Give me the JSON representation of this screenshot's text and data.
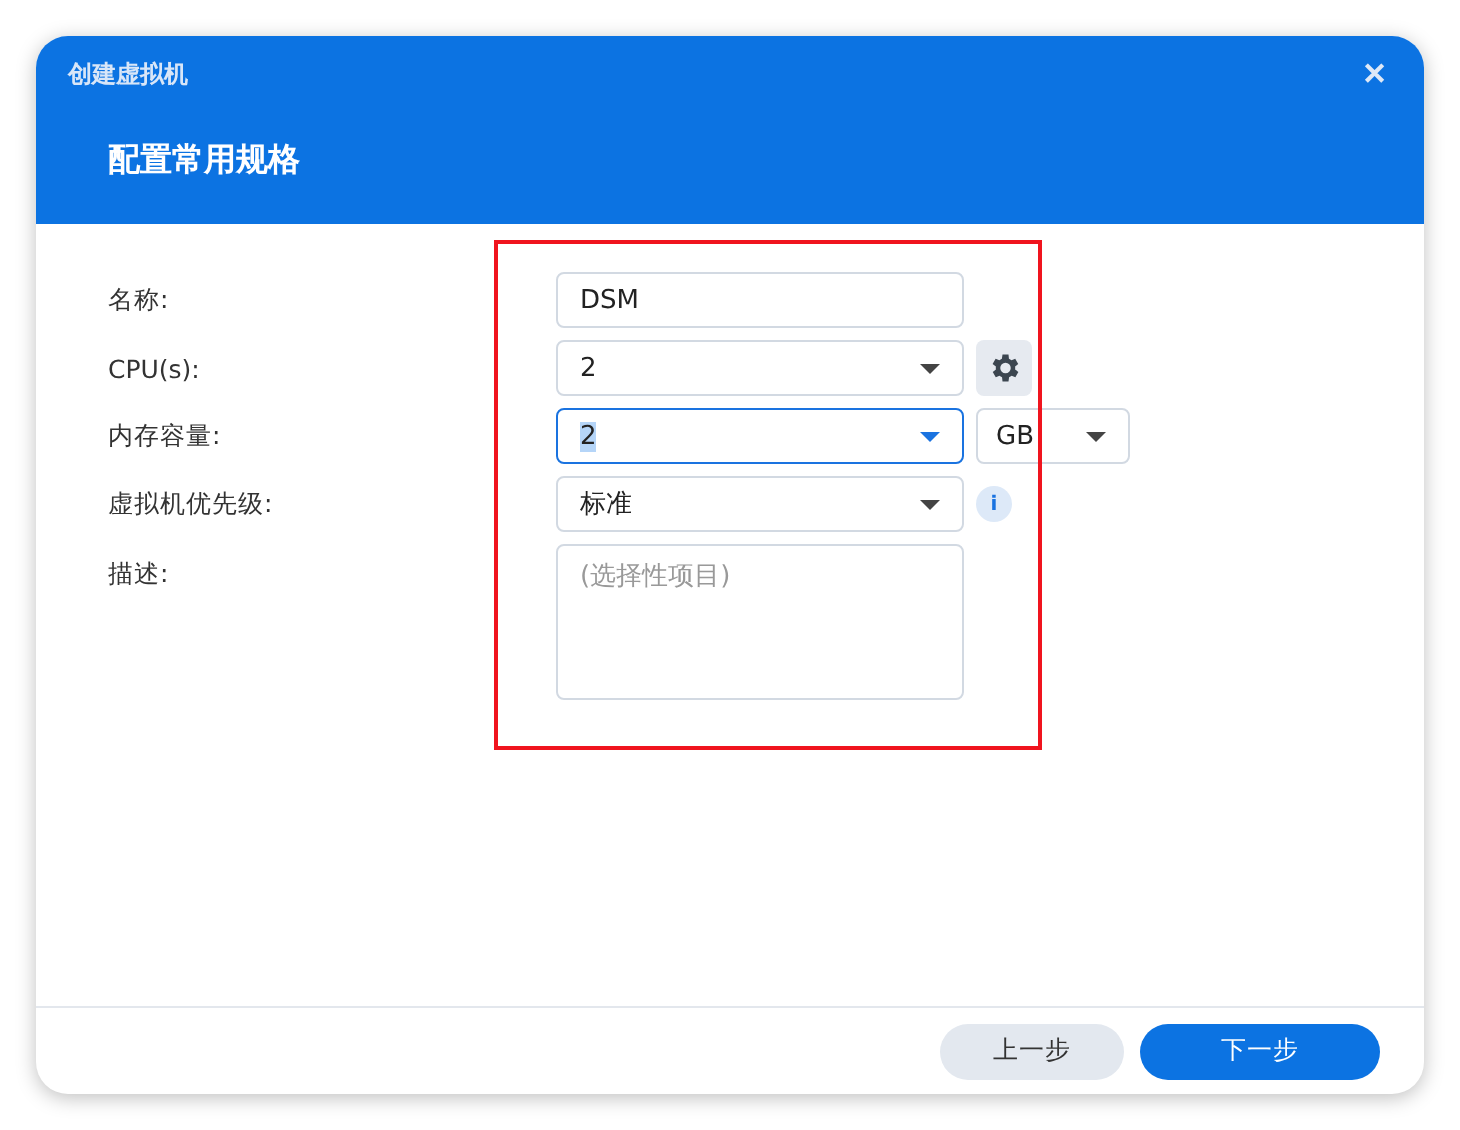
{
  "window": {
    "title": "创建虚拟机",
    "close": "✕"
  },
  "header": {
    "title": "配置常用规格"
  },
  "form": [
    {
      "label": "名称:",
      "kind": "text",
      "value": "DSM",
      "focused": false
    },
    {
      "label": "CPU(s):",
      "kind": "select",
      "value": "2",
      "focused": false,
      "extra": {
        "kind": "gear"
      }
    },
    {
      "label": "内存容量:",
      "kind": "select",
      "value": "2",
      "focused": true,
      "extra": {
        "kind": "unit",
        "value": "GB"
      }
    },
    {
      "label": "虚拟机优先级:",
      "kind": "select",
      "value": "标准",
      "focused": false,
      "extra": {
        "kind": "info",
        "text": "i"
      }
    },
    {
      "label": "描述:",
      "kind": "textarea",
      "placeholder": "(选择性项目)",
      "focused": false
    }
  ],
  "buttons": [
    {
      "label": "上一步",
      "primary": false
    },
    {
      "label": "下一步",
      "primary": true
    }
  ]
}
